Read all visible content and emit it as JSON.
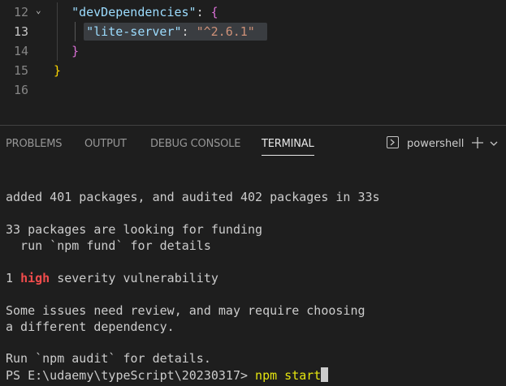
{
  "editor": {
    "lines": [
      {
        "number": "12",
        "indent": "  ",
        "key": "\"devDependencies\"",
        "sep": ": ",
        "brace": "{"
      },
      {
        "number": "13",
        "indent": "    ",
        "key": "\"lite-server\"",
        "sep": ": ",
        "value": "\"^2.6.1\""
      },
      {
        "number": "14",
        "indent": "  ",
        "brace": "}"
      },
      {
        "number": "15",
        "indent": "",
        "brace": "}"
      },
      {
        "number": "16"
      }
    ]
  },
  "panel": {
    "tabs": [
      {
        "label": "PROBLEMS"
      },
      {
        "label": "OUTPUT"
      },
      {
        "label": "DEBUG CONSOLE"
      },
      {
        "label": "TERMINAL"
      }
    ],
    "active_tab": "TERMINAL",
    "shell_label": "powershell"
  },
  "terminal": {
    "line1": "added 401 packages, and audited 402 packages in 33s",
    "line2": "33 packages are looking for funding",
    "line3": "  run `npm fund` for details",
    "line4_prefix": "1 ",
    "line4_high": "high",
    "line4_suffix": " severity vulnerability",
    "line5": "Some issues need review, and may require choosing",
    "line6": "a different dependency.",
    "line7": "Run `npm audit` for details.",
    "prompt": "PS E:\\udaemy\\typeScript\\20230317> ",
    "command": "npm start"
  },
  "colors": {
    "background": "#1e1e1e",
    "high_severity": "#f14c4c",
    "command": "#e5e510"
  }
}
